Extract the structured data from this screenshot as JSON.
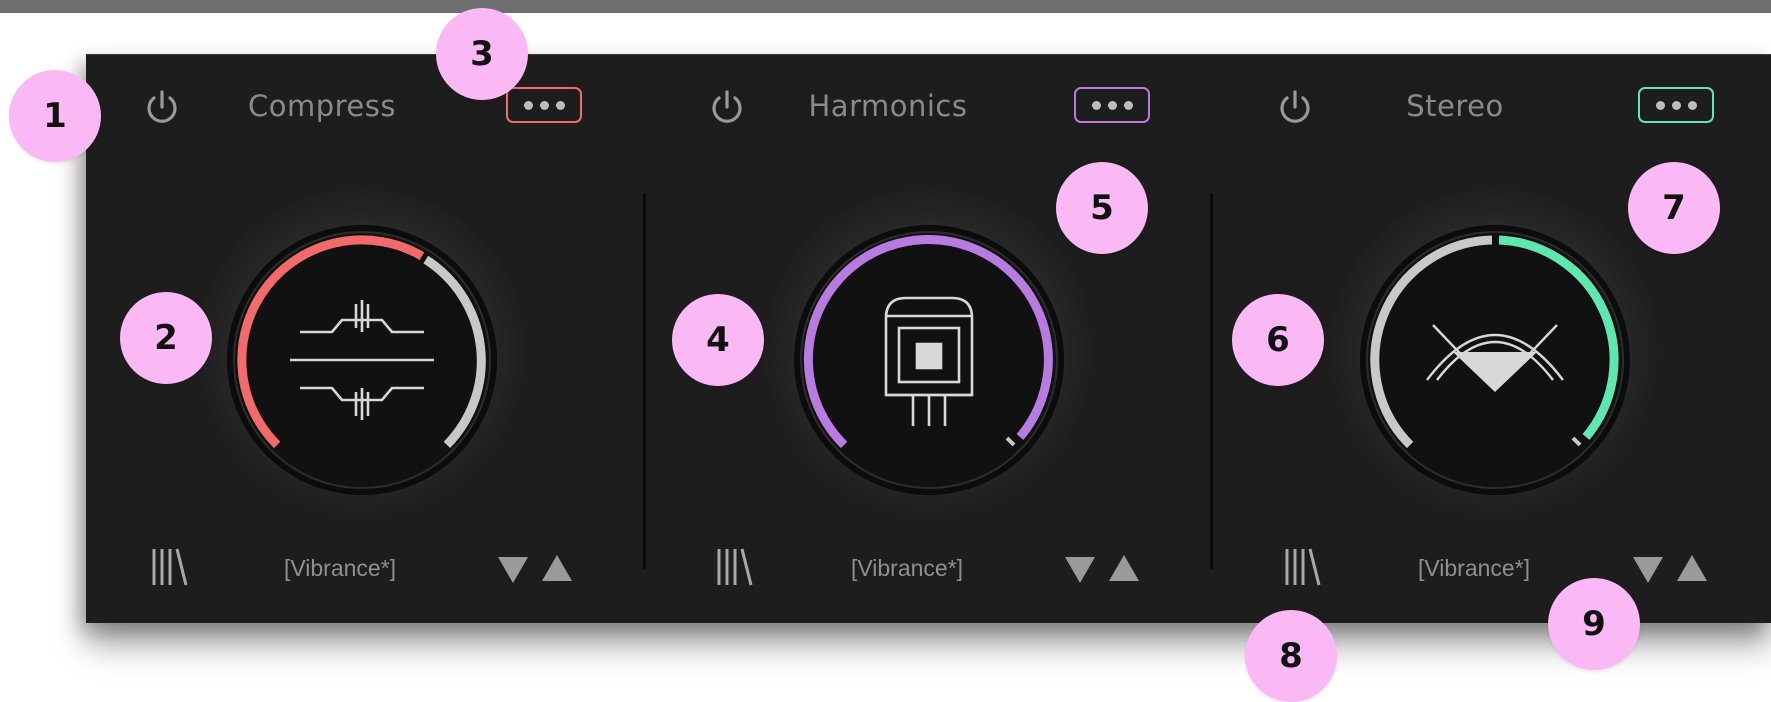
{
  "modules": [
    {
      "title": "Compress",
      "preset": "[Vibrance*]",
      "accent": "#f26a6a",
      "menu_icon": "more-dots-icon",
      "emblem_icon": "compressor-icon"
    },
    {
      "title": "Harmonics",
      "preset": "[Vibrance*]",
      "accent": "#b77be2",
      "menu_icon": "more-dots-icon",
      "emblem_icon": "vacuum-tube-icon"
    },
    {
      "title": "Stereo",
      "preset": "[Vibrance*]",
      "accent": "#5ee8b0",
      "menu_icon": "more-dots-icon",
      "emblem_icon": "stereo-width-icon"
    }
  ],
  "callouts": [
    "1",
    "2",
    "3",
    "4",
    "5",
    "6",
    "7",
    "8",
    "9"
  ]
}
